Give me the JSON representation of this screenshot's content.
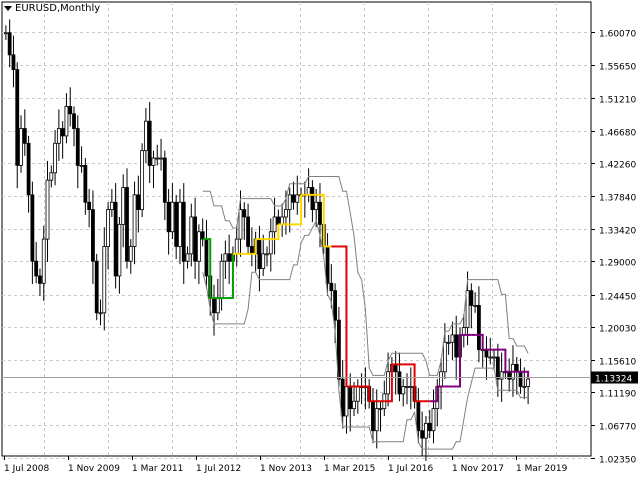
{
  "chart_title": "EURUSD,Monthly",
  "current_price_label": "1.13324",
  "colors": {
    "candle": "#000000",
    "grid": "#c8c8c8",
    "band": "#808080",
    "current_price_box": "#000000",
    "trend_yellow": "#ffd700",
    "trend_red": "#e00000",
    "trend_purple": "#800080",
    "trend_green": "#00a000"
  },
  "chart_data": {
    "type": "candlestick",
    "symbol": "EURUSD",
    "timeframe": "Monthly",
    "ylim": [
      1.0257,
      1.62
    ],
    "y_ticks": [
      1.6007,
      1.5565,
      1.5121,
      1.4668,
      1.4226,
      1.3784,
      1.3342,
      1.29,
      1.2445,
      1.2003,
      1.1561,
      1.1119,
      1.0677,
      1.0235
    ],
    "y_tick_labels": [
      "1.60070",
      "1.55650",
      "1.51210",
      "1.46680",
      "1.42260",
      "1.37840",
      "1.33420",
      "1.29000",
      "1.24450",
      "1.20030",
      "1.15610",
      "1.11190",
      "1.06770",
      "1.02350"
    ],
    "x_tick_labels": [
      "1 Jul 2008",
      "1 Nov 2009",
      "1 Mar 2011",
      "1 Jul 2012",
      "1 Nov 2013",
      "1 Mar 2015",
      "1 Jul 2016",
      "1 Nov 2017",
      "1 Mar 2019"
    ],
    "current_price": 1.13324,
    "close_series": [
      1.6,
      1.57,
      1.55,
      1.42,
      1.47,
      1.45,
      1.38,
      1.29,
      1.27,
      1.26,
      1.32,
      1.4,
      1.41,
      1.45,
      1.47,
      1.46,
      1.5,
      1.49,
      1.47,
      1.42,
      1.42,
      1.37,
      1.36,
      1.29,
      1.22,
      1.22,
      1.31,
      1.36,
      1.37,
      1.27,
      1.34,
      1.39,
      1.29,
      1.31,
      1.38,
      1.36,
      1.44,
      1.48,
      1.42,
      1.43,
      1.43,
      1.43,
      1.37,
      1.33,
      1.37,
      1.31,
      1.37,
      1.29,
      1.3,
      1.35,
      1.29,
      1.33,
      1.32,
      1.27,
      1.24,
      1.22,
      1.24,
      1.29,
      1.3,
      1.29,
      1.3,
      1.32,
      1.36,
      1.35,
      1.31,
      1.3,
      1.32,
      1.28,
      1.3,
      1.3,
      1.33,
      1.35,
      1.34,
      1.35,
      1.36,
      1.38,
      1.37,
      1.38,
      1.38,
      1.38,
      1.39,
      1.36,
      1.37,
      1.34,
      1.31,
      1.26,
      1.25,
      1.21,
      1.13,
      1.08,
      1.12,
      1.09,
      1.1,
      1.12,
      1.12,
      1.12,
      1.1,
      1.06,
      1.09,
      1.09,
      1.11,
      1.14,
      1.15,
      1.14,
      1.11,
      1.12,
      1.12,
      1.12,
      1.1,
      1.06,
      1.05,
      1.07,
      1.06,
      1.09,
      1.12,
      1.14,
      1.18,
      1.18,
      1.19,
      1.16,
      1.19,
      1.2,
      1.25,
      1.23,
      1.23,
      1.17,
      1.17,
      1.16,
      1.16,
      1.16,
      1.13,
      1.14,
      1.14,
      1.13,
      1.15,
      1.14,
      1.12,
      1.12,
      1.13
    ]
  }
}
